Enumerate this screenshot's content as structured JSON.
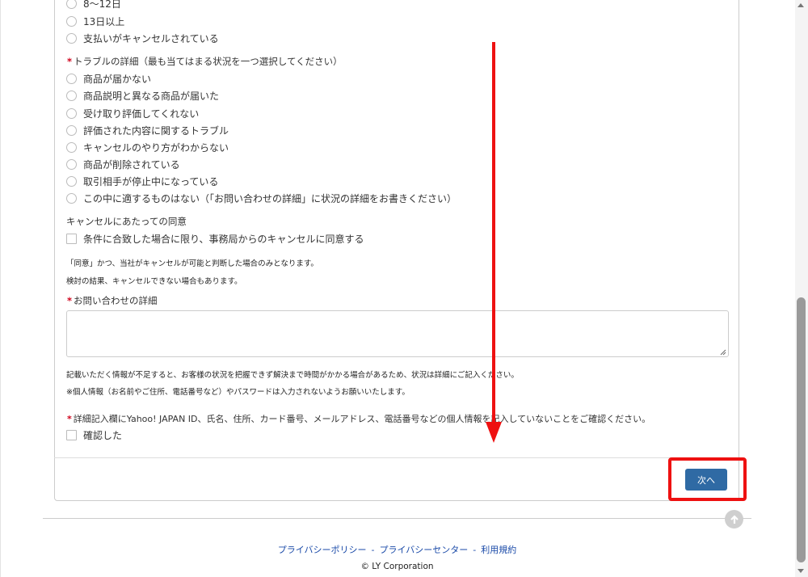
{
  "payment_status": {
    "options": [
      "8〜12日",
      "13日以上",
      "支払いがキャンセルされている"
    ]
  },
  "trouble_details": {
    "required_mark": "*",
    "label": "トラブルの詳細（最も当てはまる状況を一つ選択してください）",
    "options": [
      "商品が届かない",
      "商品説明と異なる商品が届いた",
      "受け取り評価してくれない",
      "評価された内容に関するトラブル",
      "キャンセルのやり方がわからない",
      "商品が削除されている",
      "取引相手が停止中になっている",
      "この中に適するものはない（「お問い合わせの詳細」に状況の詳細をお書きください）"
    ]
  },
  "cancel_consent": {
    "label": "キャンセルにあたっての同意",
    "checkbox_label": "条件に合致した場合に限り、事務局からのキャンセルに同意する",
    "note_1": "「同意」かつ、当社がキャンセルが可能と判断した場合のみとなります。",
    "note_2": "検討の結果、キャンセルできない場合もあります。"
  },
  "inquiry_details": {
    "required_mark": "*",
    "label": "お問い合わせの詳細",
    "value": "",
    "note_1": "記載いただく情報が不足すると、お客様の状況を把握できず解決まで時間がかかる場合があるため、状況は詳細にご記入ください。",
    "note_2": "※個人情報（お名前やご住所、電話番号など）やパスワードは入力されないようお願いいたします。"
  },
  "confirmation": {
    "required_mark": "*",
    "label": "詳細記入欄にYahoo! JAPAN ID、氏名、住所、カード番号、メールアドレス、電話番号などの個人情報を記入していないことをご確認ください。",
    "checkbox_label": "確認した"
  },
  "actions": {
    "next_label": "次へ"
  },
  "footer": {
    "links": [
      "プライバシーポリシー",
      "プライバシーセンター",
      "利用規約"
    ],
    "separator": "-",
    "copyright": "© LY Corporation"
  },
  "colors": {
    "primary_button": "#2f6aa4",
    "annotation_red": "#ee1111",
    "required_red": "#d0021b",
    "link_blue": "#1a4aa8"
  },
  "icons": [
    "scroll-to-top-icon",
    "resize-grip-icon",
    "down-arrow-annotation"
  ]
}
